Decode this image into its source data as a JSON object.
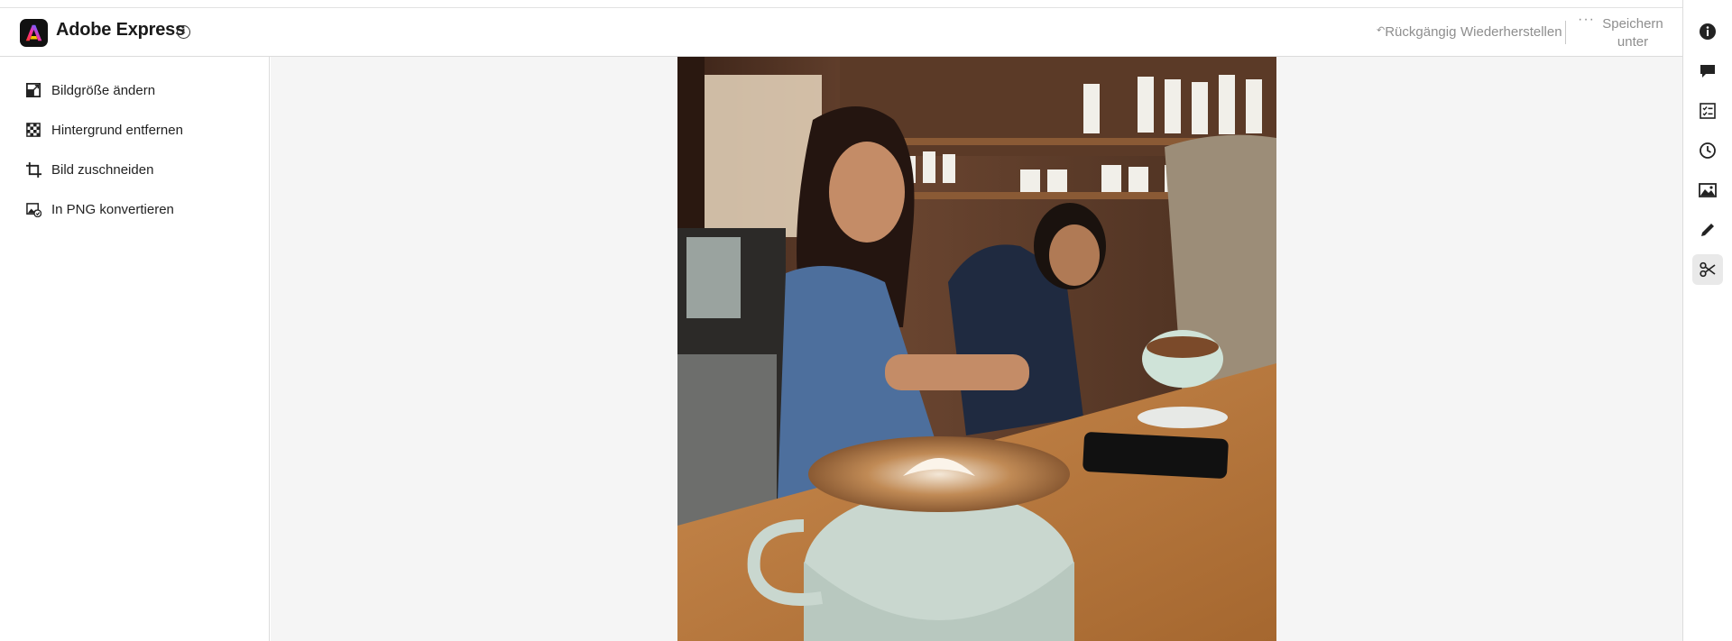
{
  "header": {
    "app_title": "Adobe Express",
    "info_icon": "info-circle-icon",
    "undo_label": "Rückgängig",
    "redo_label": "Wiederherstellen",
    "more_label": "···",
    "save_as_line1": "Speichern",
    "save_as_line2": "unter"
  },
  "sidebar": {
    "items": [
      {
        "label": "Bildgröße ändern",
        "icon": "resize-icon"
      },
      {
        "label": "Hintergrund entfernen",
        "icon": "remove-background-icon"
      },
      {
        "label": "Bild zuschneiden",
        "icon": "crop-icon"
      },
      {
        "label": "In PNG konvertieren",
        "icon": "convert-png-icon"
      }
    ]
  },
  "canvas": {
    "image_alt": "Barista at a café counter with latte art cups"
  },
  "rail": {
    "items": [
      {
        "icon": "info-icon"
      },
      {
        "icon": "comment-icon"
      },
      {
        "icon": "checklist-icon"
      },
      {
        "icon": "history-icon"
      },
      {
        "icon": "image-icon"
      },
      {
        "icon": "pencil-icon"
      },
      {
        "icon": "scissors-icon",
        "active": true
      }
    ]
  },
  "colors": {
    "canvas_bg": "#f5f5f5",
    "muted_text": "#8e8e8e",
    "active_rail": "#e9e9e9"
  }
}
